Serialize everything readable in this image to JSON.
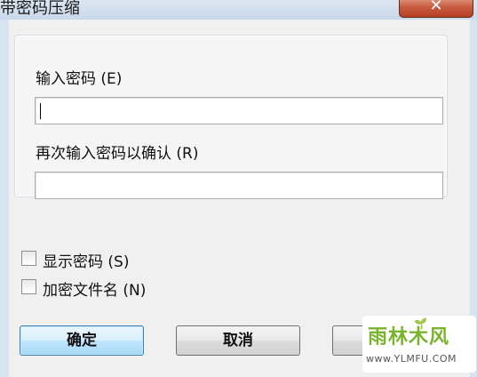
{
  "window": {
    "title": "带密码压缩",
    "close_glyph": "✕"
  },
  "form": {
    "password_label": "输入密码 (E)",
    "password_value": "",
    "confirm_label": "再次输入密码以确认 (R)",
    "confirm_value": "",
    "show_password_label": "显示密码 (S)",
    "show_password_checked": false,
    "encrypt_filenames_label": "加密文件名 (N)",
    "encrypt_filenames_checked": false
  },
  "buttons": {
    "ok_label": "确定",
    "cancel_label": "取消",
    "help_label": ""
  },
  "watermark": {
    "brand": "雨林木风",
    "url": "www.YLMFU.COM"
  },
  "icons": {
    "close": "close-icon",
    "leaf": "leaf-icon"
  }
}
